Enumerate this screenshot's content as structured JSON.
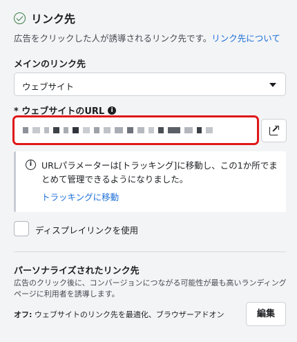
{
  "header": {
    "title": "リンク先",
    "description": "広告をクリックした人が誘導されるリンク先です。",
    "description_link": "リンク先について"
  },
  "main_link": {
    "label": "メインのリンク先",
    "selected": "ウェブサイト"
  },
  "website_url": {
    "label": "* ウェブサイトのURL",
    "info_icon": "i",
    "value_redacted": true
  },
  "notice": {
    "icon": "i",
    "text": "URLパラメーターは[トラッキング]に移動し、この1か所でまとめて管理できるようになりました。",
    "link": "トラッキングに移動"
  },
  "display_link": {
    "label": "ディスプレイリンクを使用",
    "checked": false
  },
  "personalized": {
    "title": "パーソナライズされたリンク先",
    "description": "広告のクリック後に、コンバージョンにつながる可能性が最も高いランディングページに利用者を誘導します。",
    "off_label": "オフ:",
    "off_text": " ウェブサイトのリンク先を最適化、ブラウザーアドオン",
    "edit_label": "編集"
  },
  "colors": {
    "accent_link": "#1a6ed8",
    "error_border": "#e0171a",
    "success": "#3a7d44"
  }
}
